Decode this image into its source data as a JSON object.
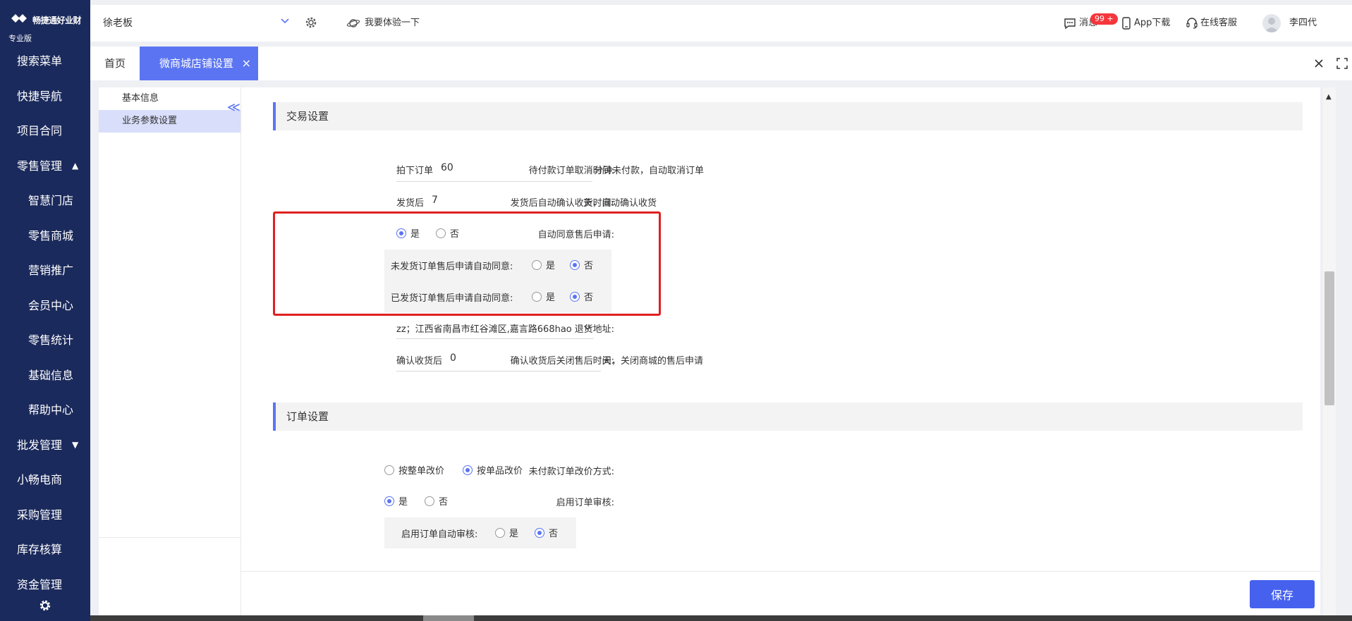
{
  "brand": {
    "name": "畅捷通好业财",
    "edition": "专业版"
  },
  "sidebar": {
    "items": [
      {
        "label": "搜索菜单"
      },
      {
        "label": "快捷导航"
      },
      {
        "label": "项目合同"
      },
      {
        "label": "零售管理",
        "arrow": "▲"
      },
      {
        "label": "智慧门店"
      },
      {
        "label": "零售商城"
      },
      {
        "label": "营销推广"
      },
      {
        "label": "会员中心"
      },
      {
        "label": "零售统计"
      },
      {
        "label": "基础信息"
      },
      {
        "label": "帮助中心"
      },
      {
        "label": "批发管理",
        "arrow": "▼"
      },
      {
        "label": "小畅电商"
      },
      {
        "label": "采购管理"
      },
      {
        "label": "库存核算"
      },
      {
        "label": "资金管理"
      }
    ],
    "footer_icon": "gear-icon"
  },
  "header": {
    "company": "徐老板",
    "experience": "我要体验一下",
    "messages_badge": "99 +",
    "messages": "消息",
    "app_download": "App下载",
    "online_service": "在线客服",
    "user_name": "李四代"
  },
  "tabs": {
    "home": "首页",
    "active": "微商城店铺设置",
    "close": "×"
  },
  "leftnav": {
    "items": [
      "基本信息",
      "业务参数设置"
    ],
    "collapse": "≪"
  },
  "trade": {
    "title": "交易设置",
    "cancel_label": "待付款订单取消时间:",
    "cancel_prefix": "拍下订单",
    "cancel_value": "60",
    "cancel_suffix": "分钟未付款，自动取消订单",
    "confirm_label": "发货后自动确认收货时间:",
    "confirm_prefix": "发货后",
    "confirm_value": "7",
    "confirm_suffix": "天，自动确认收货",
    "auto_agree_label": "自动同意售后申请:",
    "yes": "是",
    "no": "否",
    "unshipped_label": "未发货订单售后申请自动同意:",
    "shipped_label": "已发货订单售后申请自动同意:",
    "return_label": "退货地址:",
    "return_value": "zz；江西省南昌市红谷滩区,嘉言路668hao",
    "close_label": "确认收货后关闭售后时间:",
    "close_prefix": "确认收货后",
    "close_value": "0",
    "close_suffix": "天，关闭商城的售后申请"
  },
  "order": {
    "title": "订单设置",
    "price_label": "未付款订单改价方式:",
    "price_opt1": "按整单改价",
    "price_opt2": "按单品改价",
    "audit_label": "启用订单审核:",
    "auto_audit_label": "启用订单自动审核:"
  },
  "actions": {
    "save": "保存"
  },
  "colors": {
    "sidebar_bg": "#1b2a5c",
    "accent": "#5b75f2",
    "highlight": "#e02020"
  }
}
